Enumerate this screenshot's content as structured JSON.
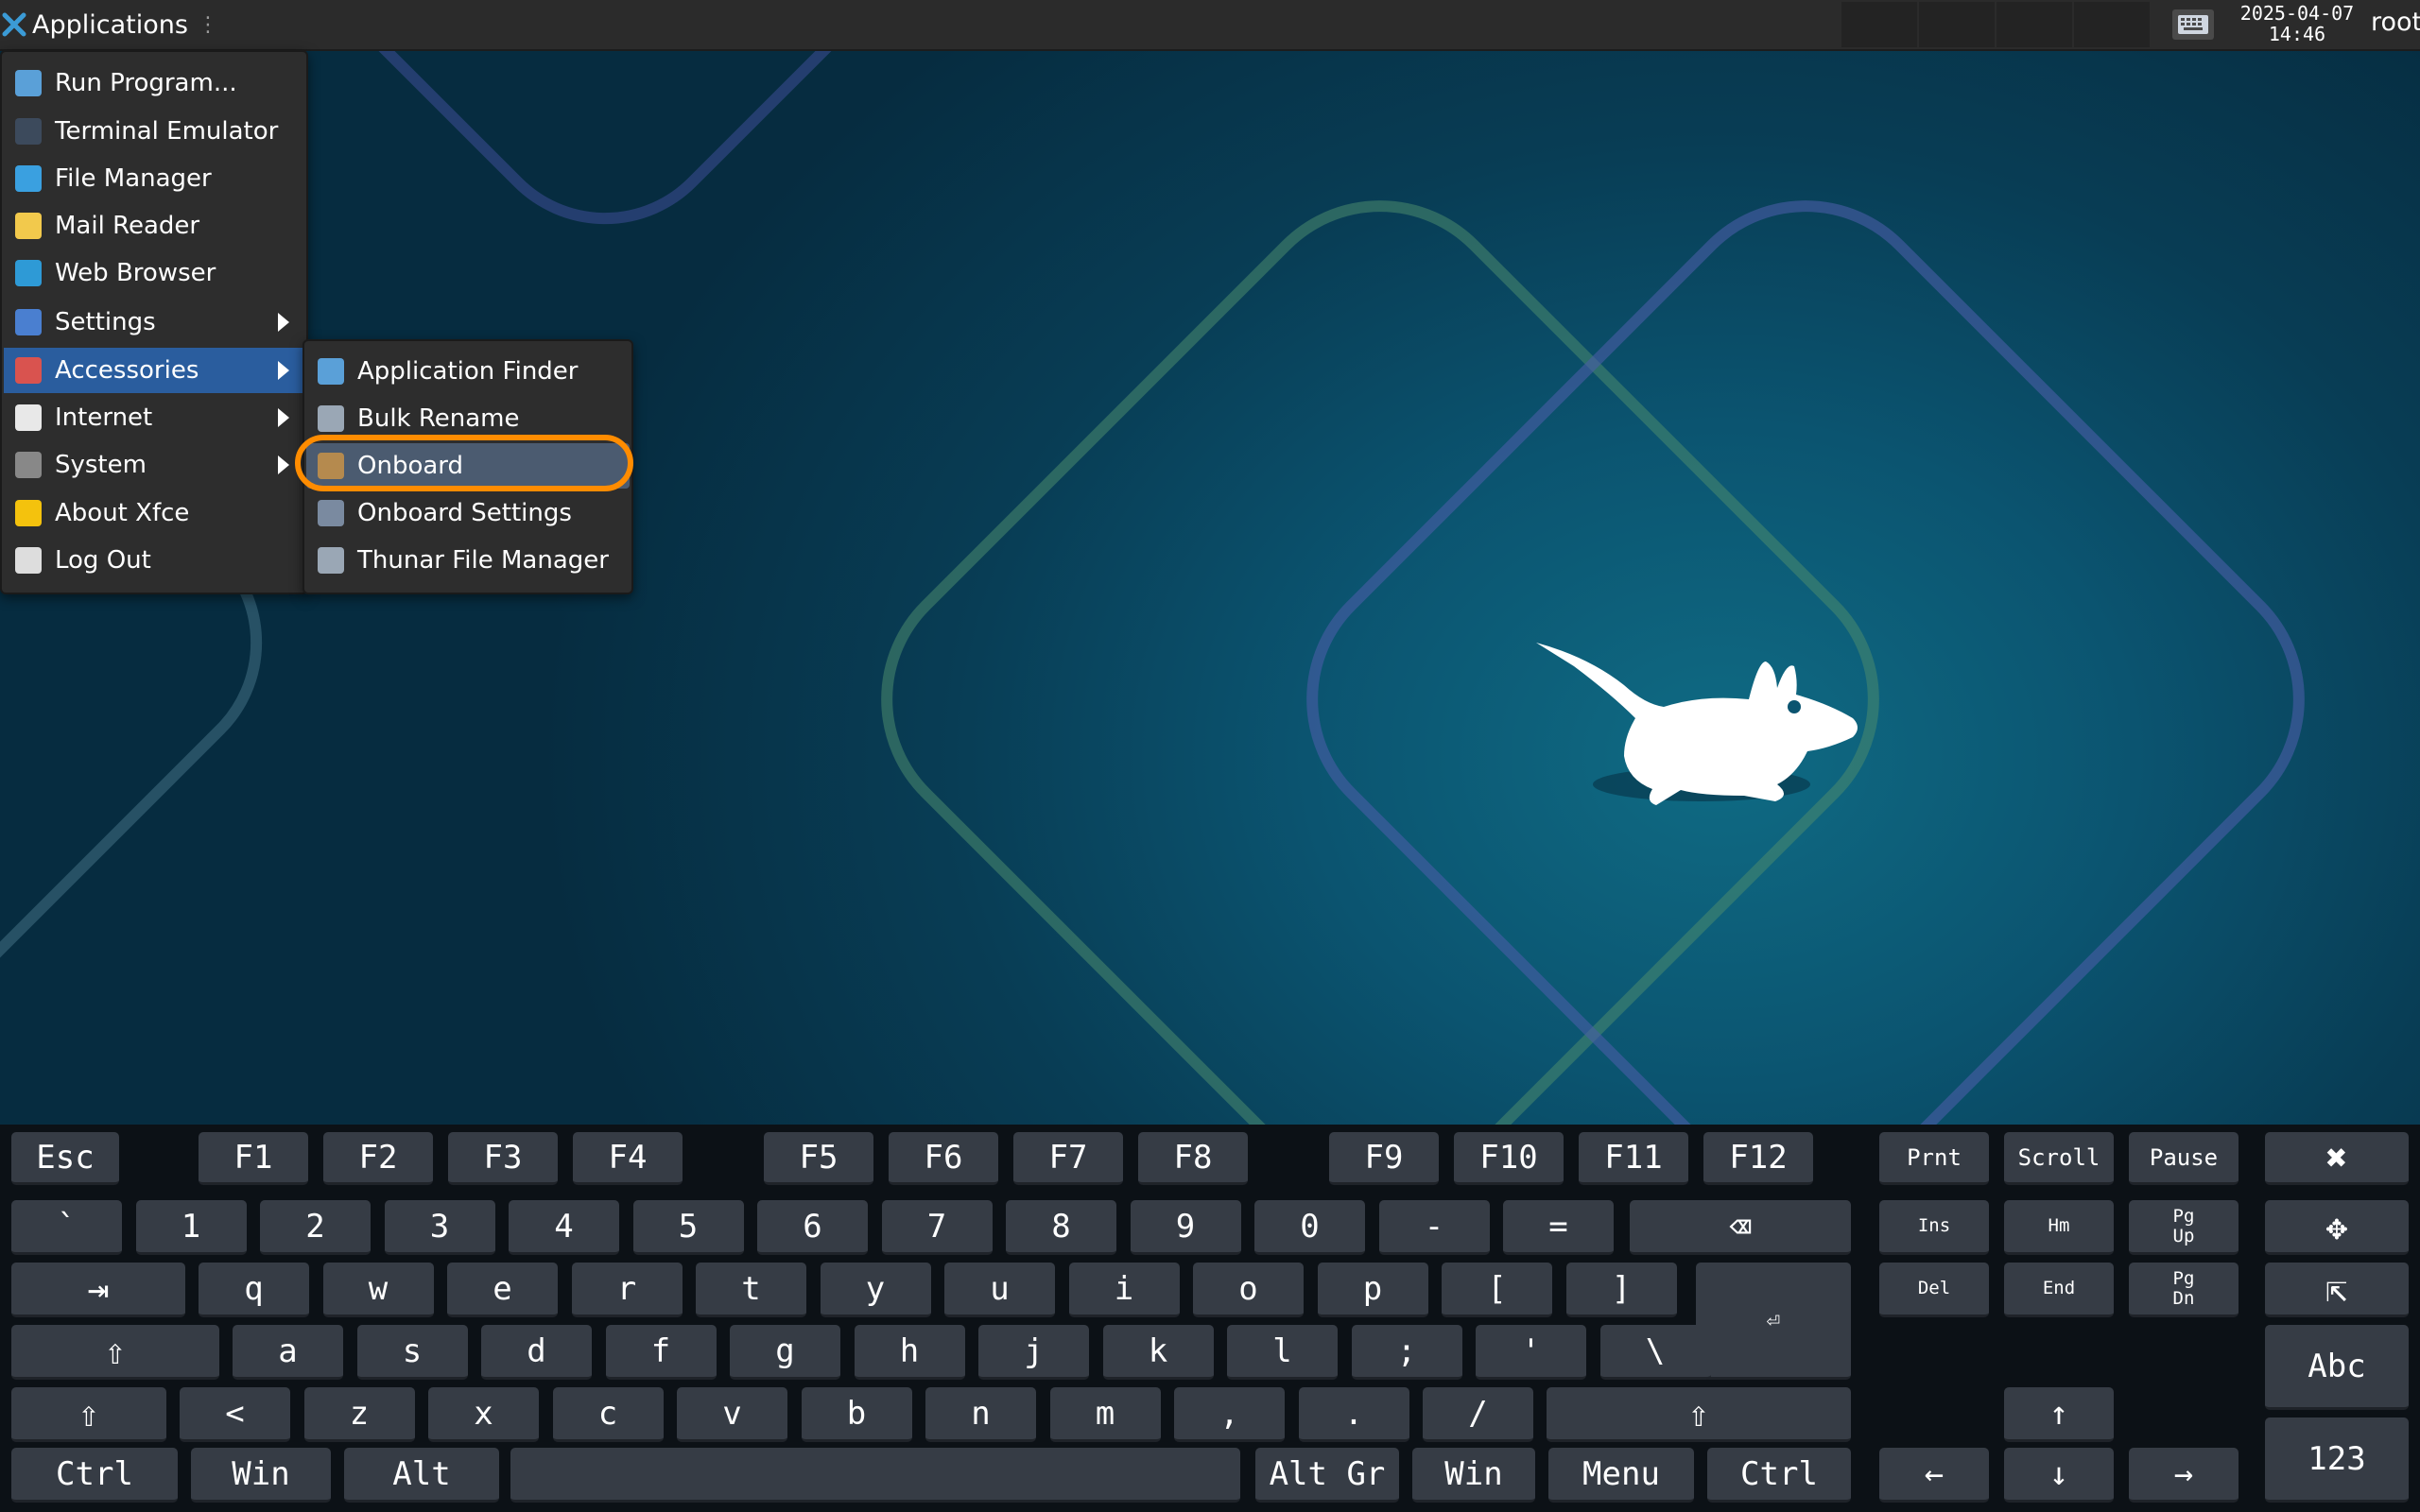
{
  "panel": {
    "apps_label": "Applications",
    "clock_date": "2025-04-07",
    "clock_time": "14:46",
    "user": "root"
  },
  "main_menu": [
    {
      "label": "Run Program...",
      "icon": "run-program-icon",
      "submenu": false
    },
    {
      "label": "Terminal Emulator",
      "icon": "terminal-icon",
      "submenu": false
    },
    {
      "label": "File Manager",
      "icon": "file-manager-icon",
      "submenu": false
    },
    {
      "label": "Mail Reader",
      "icon": "mail-icon",
      "submenu": false
    },
    {
      "label": "Web Browser",
      "icon": "web-browser-icon",
      "submenu": false
    },
    {
      "label": "Settings",
      "icon": "settings-icon",
      "submenu": true
    },
    {
      "label": "Accessories",
      "icon": "accessories-icon",
      "submenu": true,
      "selected": true
    },
    {
      "label": "Internet",
      "icon": "internet-icon",
      "submenu": true
    },
    {
      "label": "System",
      "icon": "system-icon",
      "submenu": true
    },
    {
      "label": "About Xfce",
      "icon": "star-icon",
      "submenu": false
    },
    {
      "label": "Log Out",
      "icon": "logout-icon",
      "submenu": false
    }
  ],
  "accessories_menu": [
    {
      "label": "Application Finder",
      "icon": "app-finder-icon"
    },
    {
      "label": "Bulk Rename",
      "icon": "bulk-rename-icon"
    },
    {
      "label": "Onboard",
      "icon": "onboard-icon",
      "highlighted": true
    },
    {
      "label": "Onboard Settings",
      "icon": "onboard-settings-icon"
    },
    {
      "label": "Thunar File Manager",
      "icon": "thunar-icon"
    }
  ],
  "keyboard": {
    "row_fn": [
      "Esc",
      "F1",
      "F2",
      "F3",
      "F4",
      "F5",
      "F6",
      "F7",
      "F8",
      "F9",
      "F10",
      "F11",
      "F12"
    ],
    "row_num": [
      "`",
      "1",
      "2",
      "3",
      "4",
      "5",
      "6",
      "7",
      "8",
      "9",
      "0",
      "-",
      "="
    ],
    "row_q": [
      "q",
      "w",
      "e",
      "r",
      "t",
      "y",
      "u",
      "i",
      "o",
      "p",
      "[",
      "]"
    ],
    "row_a": [
      "a",
      "s",
      "d",
      "f",
      "g",
      "h",
      "j",
      "k",
      "l",
      ";",
      "'",
      "\\"
    ],
    "row_z": [
      "<",
      "z",
      "x",
      "c",
      "v",
      "b",
      "n",
      "m",
      ",",
      ".",
      "/"
    ],
    "row_bottom": [
      "Ctrl",
      "Win",
      "Alt",
      "Alt Gr",
      "Win",
      "Menu",
      "Ctrl"
    ],
    "nav_top": [
      "Prnt",
      "Scroll",
      "Pause"
    ],
    "nav_mid": [
      "Ins",
      "Hm",
      "Pg\nUp",
      "Del",
      "End",
      "Pg\nDn"
    ],
    "arrows": [
      "↑",
      "←",
      "↓",
      "→"
    ],
    "mode_keys": [
      "Abc",
      "123"
    ],
    "symbols": {
      "backspace": "⌫",
      "tab": "⇥",
      "caps": "⇧",
      "enter": "⏎",
      "shift_left": "⇧",
      "shift_right": "⇧",
      "close": "✖",
      "move": "✥",
      "pointer": "⇱"
    }
  }
}
